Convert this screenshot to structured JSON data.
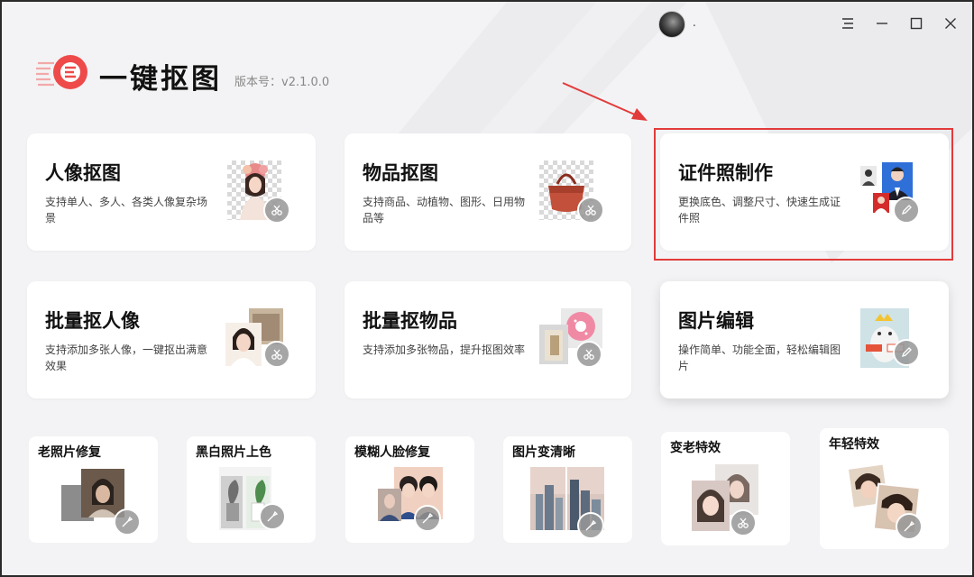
{
  "window": {
    "username": ".",
    "controls": {
      "menu": "menu-icon",
      "minimize": "minimize-icon",
      "maximize": "maximize-icon",
      "close": "close-icon"
    }
  },
  "app": {
    "title": "一键抠图",
    "version": "版本号：v2.1.0.0",
    "brand_color": "#ee4a4a"
  },
  "cards": [
    {
      "title": "人像抠图",
      "desc": "支持单人、多人、各类人像复杂场景",
      "icon": "portrait-cutout-icon"
    },
    {
      "title": "物品抠图",
      "desc": "支持商品、动植物、图形、日用物品等",
      "icon": "object-cutout-icon"
    },
    {
      "title": "证件照制作",
      "desc": "更换底色、调整尺寸、快速生成证件照",
      "icon": "id-photo-icon",
      "highlighted": true
    },
    {
      "title": "批量抠人像",
      "desc": "支持添加多张人像，一键抠出满意效果",
      "icon": "batch-portrait-icon"
    },
    {
      "title": "批量抠物品",
      "desc": "支持添加多张物品，提升抠图效率",
      "icon": "batch-object-icon"
    },
    {
      "title": "图片编辑",
      "desc": "操作简单、功能全面，轻松编辑图片",
      "icon": "image-edit-icon"
    }
  ],
  "small_cards": [
    {
      "title": "老照片修复",
      "icon": "old-photo-repair-icon"
    },
    {
      "title": "黑白照片上色",
      "icon": "colorize-icon"
    },
    {
      "title": "模糊人脸修复",
      "icon": "face-repair-icon"
    },
    {
      "title": "图片变清晰",
      "icon": "sharpen-icon"
    },
    {
      "title": "变老特效",
      "icon": "aging-effect-icon"
    },
    {
      "title": "年轻特效",
      "icon": "youth-effect-icon"
    }
  ],
  "highlight_color": "#e23b3b"
}
